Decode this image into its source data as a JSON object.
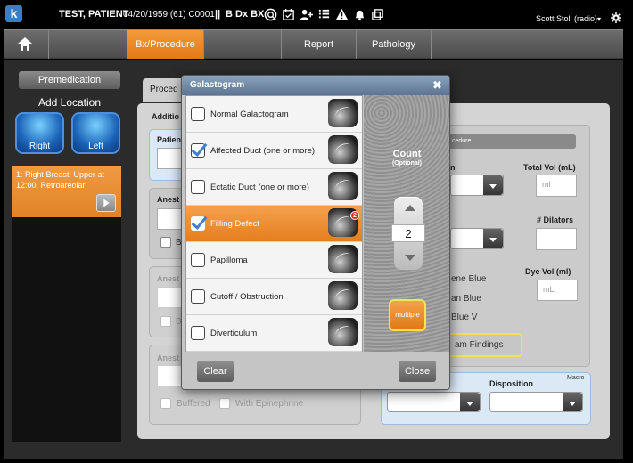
{
  "patient": {
    "name": "TEST, PATIENT",
    "dob_info": "04/20/1959 (61) C0001",
    "separator": "||",
    "mode": "B Dx BX"
  },
  "logo": {
    "letter": "k"
  },
  "toolbar_icons": [
    "globe-q-icon",
    "calendar-check-icon",
    "add-user-icon",
    "list-icon",
    "warning-icon",
    "bell-icon",
    "copy-icon"
  ],
  "user": {
    "name": "Scott Stoll (radio)"
  },
  "nav": {
    "tabs": [
      {
        "label": "Bx/Procedure",
        "active": true
      },
      {
        "label": ""
      },
      {
        "label": "Report"
      },
      {
        "label": "Pathology"
      }
    ]
  },
  "left": {
    "premedication": "Premedication",
    "add_location": "Add Location",
    "right": "Right",
    "left": "Left",
    "location_item": "1: Right Breast: Upper at 12:00, Retroareolar"
  },
  "form": {
    "tab": "Proced",
    "additional": "Additio",
    "patient_label": "Patien",
    "anesthetic_1": "Anest",
    "buffered_short": "B",
    "anesthetic_2": "Anest",
    "buffered_short_2": "B",
    "anesthetic_3": "Anest",
    "buffered": "Buffered",
    "with_epinephrine": "With Epinephrine",
    "procedure_pill": "cedure",
    "field_n_label": "n",
    "total_vol_label": "Total Vol (mL)",
    "total_vol_placeholder": "ml",
    "dilators_label": "# Dilators",
    "dye_vol_label": "Dye Vol (ml)",
    "dye_vol_placeholder": "mL",
    "dye_1": "ene Blue",
    "dye_2": "an Blue",
    "dye_3": "Blue V",
    "exam_findings": "am Findings",
    "disposition_label": "Disposition",
    "macro": "Macro"
  },
  "modal": {
    "title": "Galactogram",
    "items": [
      {
        "label": "Normal Galactogram",
        "checked": false,
        "selected": false
      },
      {
        "label": "Affected Duct (one or more)",
        "checked": true,
        "selected": false
      },
      {
        "label": "Ectatic Duct (one or more)",
        "checked": false,
        "selected": false
      },
      {
        "label": "Filling Defect",
        "checked": true,
        "selected": true,
        "badge": "2"
      },
      {
        "label": "Papilloma",
        "checked": false,
        "selected": false
      },
      {
        "label": "Cutoff / Obstruction",
        "checked": false,
        "selected": false
      },
      {
        "label": "Diverticulum",
        "checked": false,
        "selected": false
      }
    ],
    "count_title": "Count",
    "count_sub": "(Optional)",
    "count_value": "2",
    "multiple": "multiple",
    "clear": "Clear",
    "close": "Close"
  },
  "colors": {
    "accent": "#e8892a",
    "header_blue": "#6f89a7",
    "check_blue": "#3f7fd1"
  }
}
